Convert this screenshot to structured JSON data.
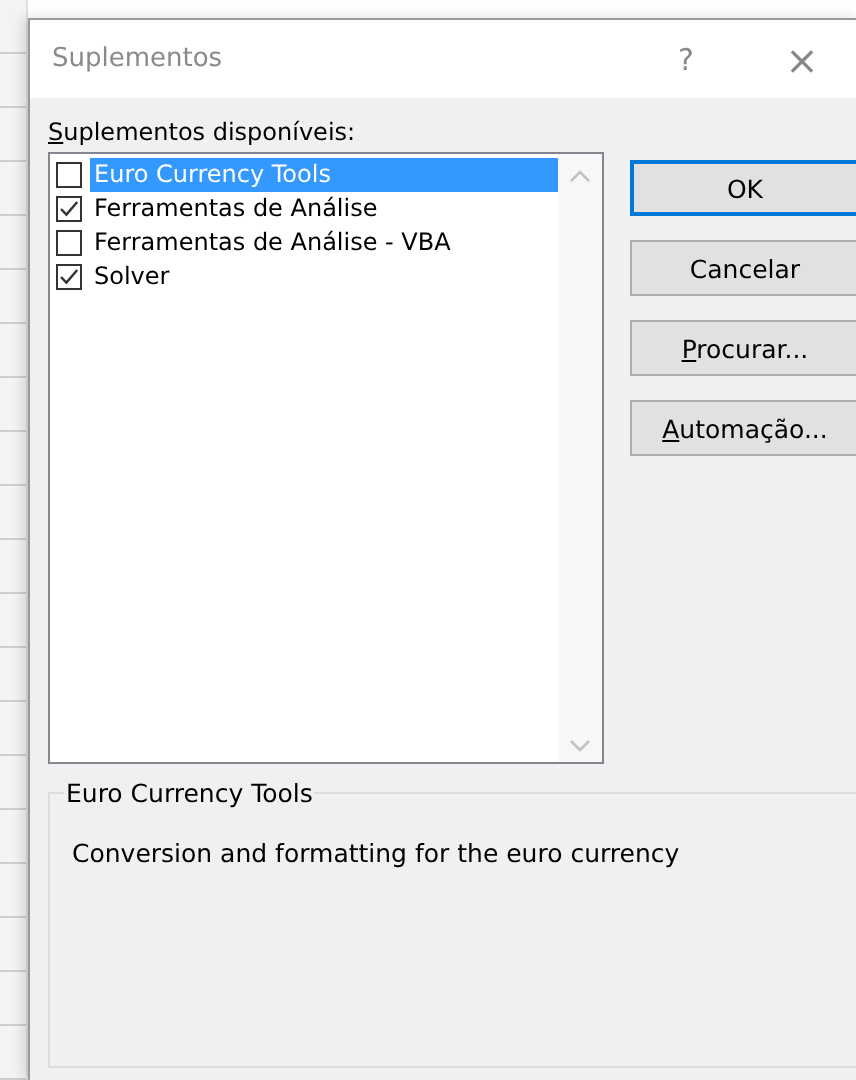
{
  "window": {
    "title": "Suplementos",
    "help": "?",
    "close": "×"
  },
  "list_label": {
    "text": "Suplementos disponíveis:",
    "mnemonic_first": true
  },
  "addins": [
    {
      "label": "Euro Currency Tools",
      "checked": false,
      "selected": true
    },
    {
      "label": "Ferramentas de Análise",
      "checked": true,
      "selected": false
    },
    {
      "label": "Ferramentas de Análise - VBA",
      "checked": false,
      "selected": false
    },
    {
      "label": "Solver",
      "checked": true,
      "selected": false
    }
  ],
  "buttons": [
    {
      "label": "OK",
      "default": true,
      "mnemonic_first": false
    },
    {
      "label": "Cancelar",
      "default": false,
      "mnemonic_first": false
    },
    {
      "label": "Procurar...",
      "default": false,
      "mnemonic_first": true
    },
    {
      "label": "Automação...",
      "default": false,
      "mnemonic_first": true
    }
  ],
  "description": {
    "title": "Euro Currency Tools",
    "text": "Conversion and formatting for the euro currency"
  }
}
